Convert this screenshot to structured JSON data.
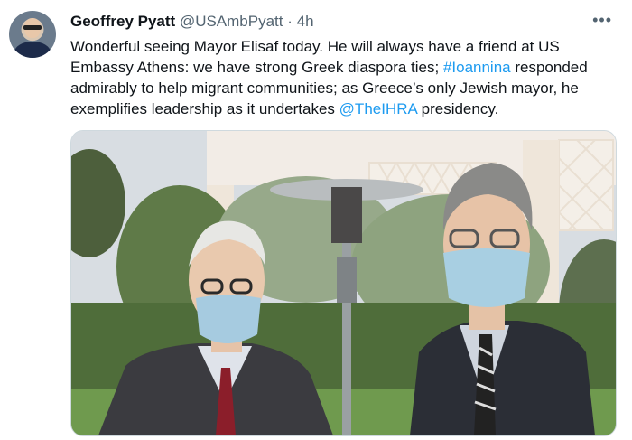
{
  "tweet": {
    "author_name": "Geoffrey Pyatt",
    "handle": "@USAmbPyatt",
    "separator": "·",
    "time": "4h",
    "more_icon": "more-horizontal-icon",
    "text_part1": "Wonderful seeing Mayor Elisaf today. He will always have a friend at US Embassy Athens: we have strong Greek diaspora ties; ",
    "hashtag": "#Ioannina",
    "text_part2": " responded admirably to help migrant communities; as Greece’s only Jewish mayor, he exemplifies leadership as it undertakes ",
    "mention": "@TheIHRA",
    "text_part3": " presidency."
  },
  "colors": {
    "text": "#0f1419",
    "secondary": "#536471",
    "link": "#1d9bf0"
  }
}
